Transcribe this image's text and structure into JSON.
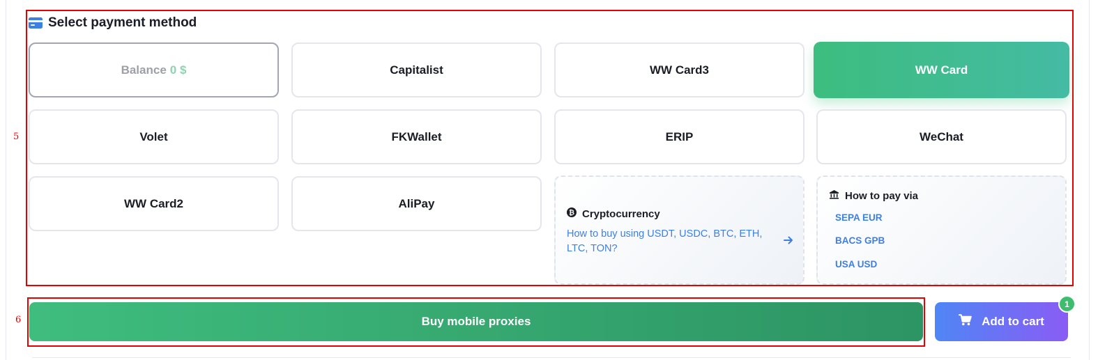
{
  "section": {
    "title": "Select payment method"
  },
  "methods": {
    "balance": {
      "label": "Balance",
      "amount": "0 $"
    },
    "capitalist": "Capitalist",
    "wwcard3": "WW Card3",
    "wwcard": "WW Card",
    "volet": "Volet",
    "fkwallet": "FKWallet",
    "erip": "ERIP",
    "wechat": "WeChat",
    "wwcard2": "WW Card2",
    "alipay": "AliPay"
  },
  "crypto": {
    "title": "Cryptocurrency",
    "link_text": "How to buy using USDT, USDC, BTC, ETH, LTC, TON?"
  },
  "howto": {
    "title": "How to pay via",
    "links": [
      "SEPA EUR",
      "BACS GPB",
      "USA USD"
    ]
  },
  "actions": {
    "buy_label": "Buy mobile proxies",
    "add_to_cart_label": "Add to cart",
    "cart_count": "1"
  },
  "annotations": {
    "payment_section": "5",
    "buy_section": "6"
  },
  "colors": {
    "accent_green": "#3dbd7f",
    "link_blue": "#3d7fe3",
    "annotation_red": "#e60000",
    "cart_gradient_start": "#4f86f5",
    "cart_gradient_end": "#8a5cf5"
  },
  "icons": {
    "section": "credit-card-icon",
    "crypto": "bitcoin-icon",
    "howto": "bank-icon",
    "crypto_arrow": "arrow-right-icon",
    "cart": "shopping-cart-icon"
  }
}
